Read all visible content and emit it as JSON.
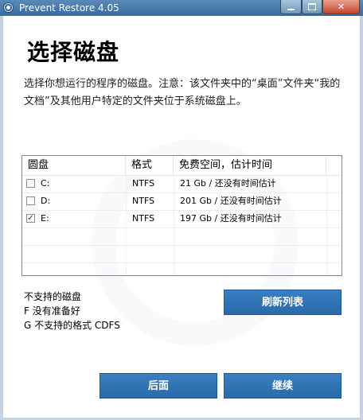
{
  "window": {
    "title": "Prevent Restore 4.05",
    "close_glyph": "✕"
  },
  "page": {
    "heading": "选择磁盘",
    "description": "选择你想运行的程序的磁盘。注意：该文件夹中的“桌面”文件夹“我的文档”及其他用户特定的文件夹位于系统磁盘上。"
  },
  "table": {
    "headers": {
      "disk": "圆盘",
      "format": "格式",
      "space": "免费空间，估计时间"
    },
    "rows": [
      {
        "checked": false,
        "disk": "C:",
        "format": "NTFS",
        "space": "21 Gb / 还没有时间估计"
      },
      {
        "checked": false,
        "disk": "D:",
        "format": "NTFS",
        "space": "201 Gb / 还没有时间估计"
      },
      {
        "checked": true,
        "disk": "E:",
        "format": "NTFS",
        "space": "197 Gb / 还没有时间估计"
      }
    ],
    "check_glyph": "✓"
  },
  "unsupported": {
    "title": "不支持的磁盘",
    "lines": [
      "F 没有准备好",
      "G 不支持的格式 CDFS"
    ]
  },
  "buttons": {
    "refresh": "刷新列表",
    "back": "后面",
    "next": "继续"
  }
}
